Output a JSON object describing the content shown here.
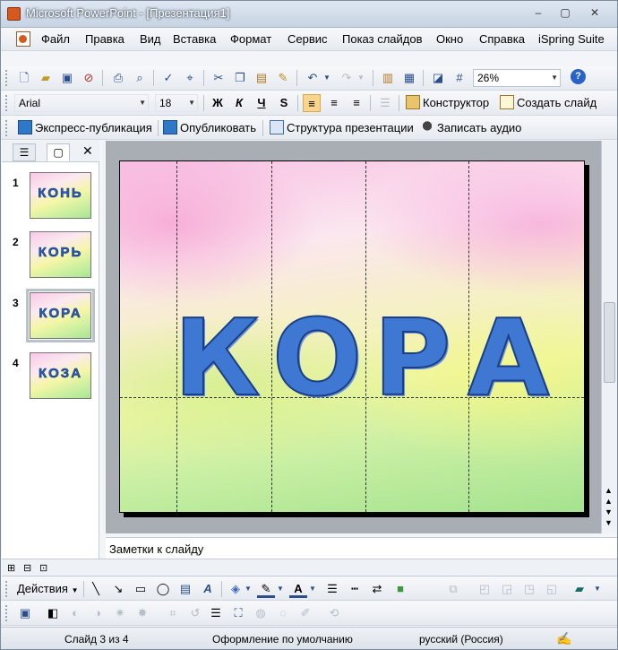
{
  "window": {
    "title": "Microsoft PowerPoint - [Презентация1]",
    "min": "–",
    "max": "▢",
    "close": "✕"
  },
  "menu": [
    "Файл",
    "Правка",
    "Вид",
    "Вставка",
    "Формат",
    "Сервис",
    "Показ слайдов",
    "Окно",
    "Справка",
    "iSpring Suite"
  ],
  "standard_toolbar": {
    "zoom": "26%"
  },
  "format_toolbar": {
    "font": "Arial",
    "size": "18",
    "bold": "Ж",
    "italic": "К",
    "underline": "Ч",
    "shadow": "S",
    "designer": "Конструктор",
    "new_slide": "Создать слайд"
  },
  "ispring_toolbar": {
    "express": "Экспресс-публикация",
    "publish": "Опубликовать",
    "structure": "Структура презентации",
    "record": "Записать аудио"
  },
  "slides": [
    {
      "num": "1",
      "word": "КОНЬ"
    },
    {
      "num": "2",
      "word": "КОРЬ"
    },
    {
      "num": "3",
      "word": "КОРА"
    },
    {
      "num": "4",
      "word": "КОЗА"
    }
  ],
  "current_slide": {
    "letters": [
      "К",
      "О",
      "Р",
      "А"
    ]
  },
  "notes": {
    "placeholder": "Заметки к слайду"
  },
  "drawing_toolbar": {
    "actions": "Действия"
  },
  "status": {
    "slide": "Слайд 3 из 4",
    "design": "Оформление по умолчанию",
    "language": "русский (Россия)"
  },
  "colors": {
    "accent": "#3f78d2",
    "title_bar": "#c6d3e2",
    "stage": "#a9aeb5"
  }
}
